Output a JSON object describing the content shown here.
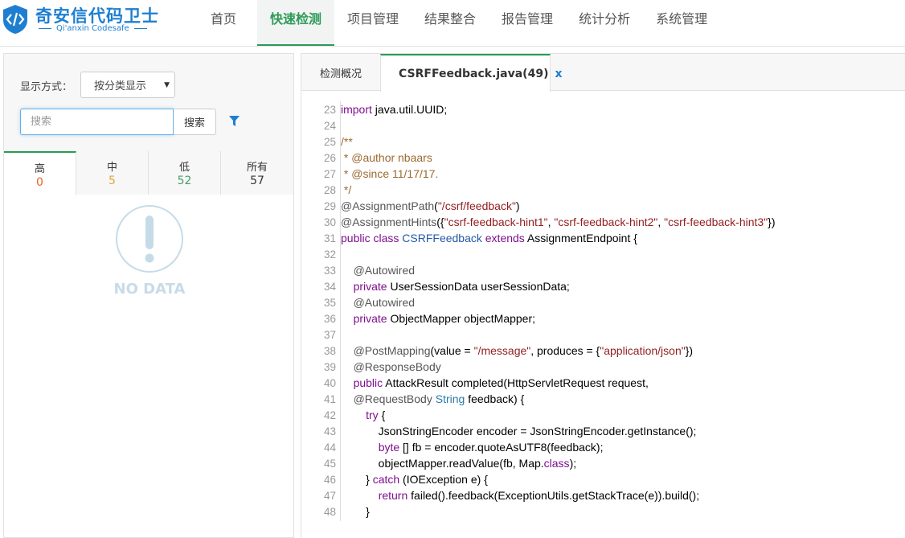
{
  "app": {
    "logo_title": "奇安信代码卫士",
    "logo_sub": "Qi'anxin Codesafe"
  },
  "nav": {
    "items": [
      "首页",
      "快速检测",
      "项目管理",
      "结果整合",
      "报告管理",
      "统计分析",
      "系统管理"
    ],
    "active": "快速检测"
  },
  "left": {
    "display_label": "显示方式：",
    "display_value": "按分类显示",
    "search_placeholder": "搜索",
    "search_button": "搜索",
    "severity_tabs": [
      {
        "label": "高",
        "count": "0"
      },
      {
        "label": "中",
        "count": "5"
      },
      {
        "label": "低",
        "count": "52"
      },
      {
        "label": "所有",
        "count": "57"
      }
    ],
    "no_data": "NO DATA"
  },
  "right": {
    "tabs": [
      "检测概况",
      "CSRFFeedback.java(49)"
    ],
    "tab_close": "x",
    "code_lines": [
      {
        "n": "23",
        "html": "import java.util.UUID;"
      },
      {
        "n": "24",
        "html": ""
      },
      {
        "n": "25",
        "html": "/**"
      },
      {
        "n": "26",
        "html": " * @author nbaars"
      },
      {
        "n": "27",
        "html": " * @since 11/17/17."
      },
      {
        "n": "28",
        "html": " */"
      },
      {
        "n": "29",
        "html": "@AssignmentPath(\"/csrf/feedback\")"
      },
      {
        "n": "30",
        "html": "@AssignmentHints({\"csrf-feedback-hint1\", \"csrf-feedback-hint2\", \"csrf-feedback-hint3\"})"
      },
      {
        "n": "31",
        "html": "public class CSRFFeedback extends AssignmentEndpoint {"
      },
      {
        "n": "32",
        "html": ""
      },
      {
        "n": "33",
        "html": "    @Autowired"
      },
      {
        "n": "34",
        "html": "    private UserSessionData userSessionData;"
      },
      {
        "n": "35",
        "html": "    @Autowired"
      },
      {
        "n": "36",
        "html": "    private ObjectMapper objectMapper;"
      },
      {
        "n": "37",
        "html": ""
      },
      {
        "n": "38",
        "html": "    @PostMapping(value = \"/message\", produces = {\"application/json\"})"
      },
      {
        "n": "39",
        "html": "    @ResponseBody"
      },
      {
        "n": "40",
        "html": "    public AttackResult completed(HttpServletRequest request,"
      },
      {
        "n": "41",
        "html": "    @RequestBody String feedback) {"
      },
      {
        "n": "42",
        "html": "        try {"
      },
      {
        "n": "43",
        "html": "            JsonStringEncoder encoder = JsonStringEncoder.getInstance();"
      },
      {
        "n": "44",
        "html": "            byte [] fb = encoder.quoteAsUTF8(feedback);"
      },
      {
        "n": "45",
        "html": "            objectMapper.readValue(fb, Map.class);"
      },
      {
        "n": "46",
        "html": "        } catch (IOException e) {"
      },
      {
        "n": "47",
        "html": "            return failed().feedback(ExceptionUtils.getStackTrace(e)).build();"
      },
      {
        "n": "48",
        "html": "        }"
      }
    ]
  },
  "colors": {
    "brand": "#1e7fd0",
    "accent": "#2c9a57",
    "high": "#e8622a",
    "mid": "#e0a63a",
    "low": "#46a06b"
  }
}
